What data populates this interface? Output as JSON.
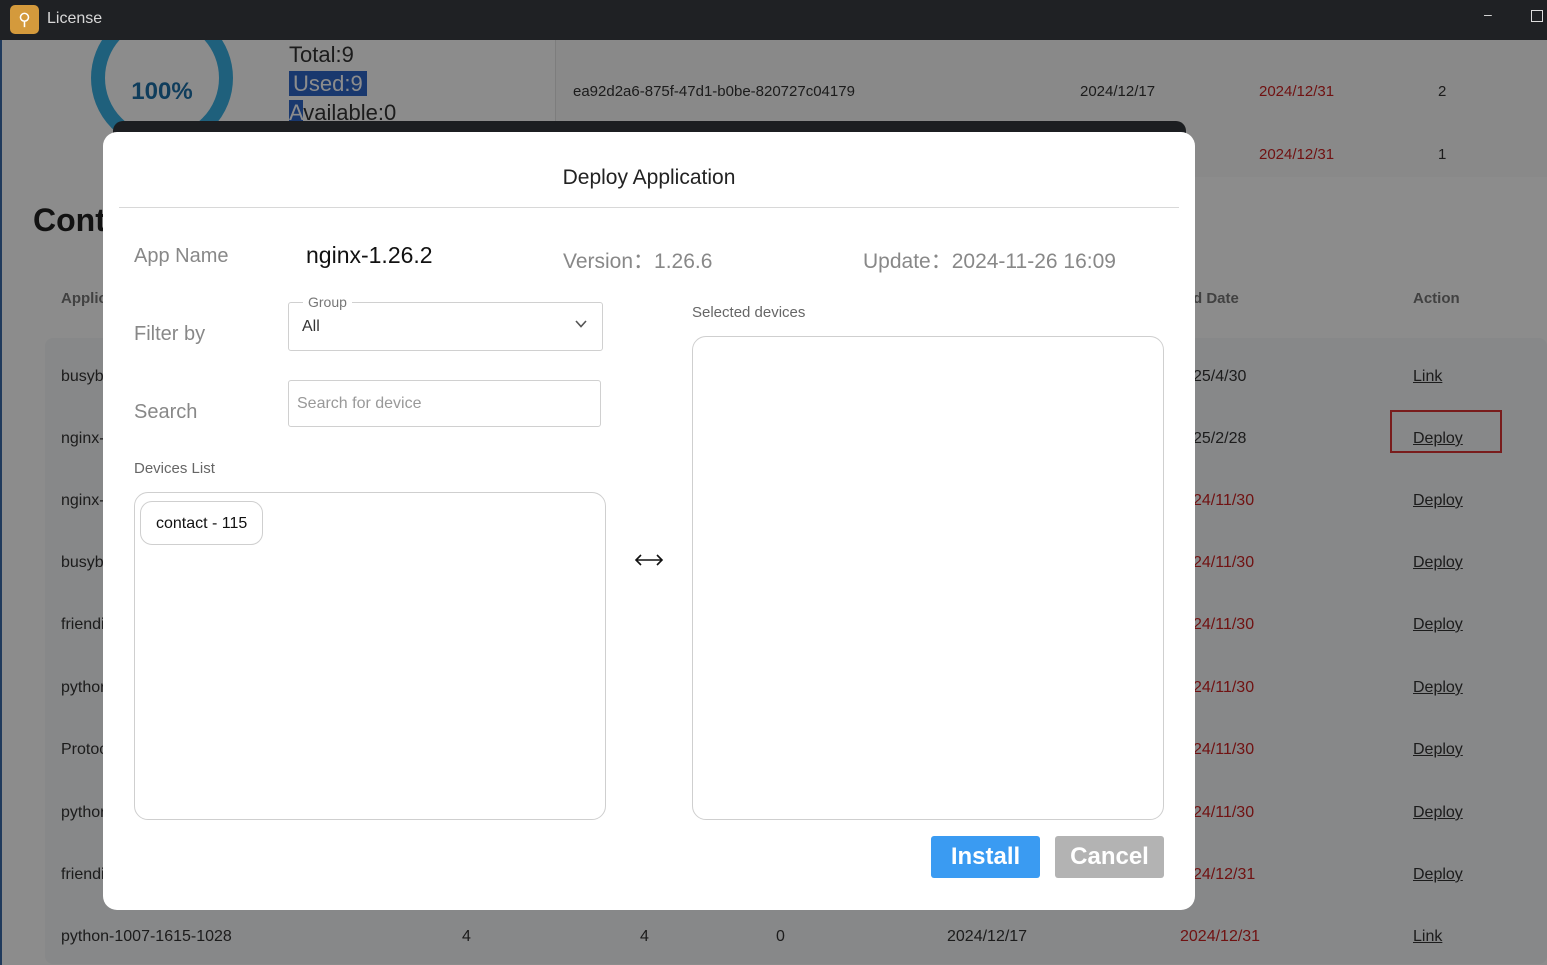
{
  "window": {
    "title": "License"
  },
  "license": {
    "percent": "100%",
    "total": "Total:9",
    "used": "Used:9",
    "available_first": "A",
    "available_rest": "vailable:0",
    "rows": [
      {
        "key": "ea92d2a6-875f-47d1-b0be-820727c04179",
        "start": "2024/12/17",
        "end": "2024/12/31",
        "count": "2"
      },
      {
        "key": "",
        "start": "",
        "end": "2024/12/31",
        "count": "1"
      }
    ]
  },
  "section": {
    "title": "Conta"
  },
  "table": {
    "headers": {
      "application": "Applic",
      "end_date": "d Date",
      "action": "Action"
    },
    "rows": [
      {
        "name": "busyb",
        "end": "25/4/30",
        "end_red": false,
        "action": "Link"
      },
      {
        "name": "nginx-",
        "end": "25/2/28",
        "end_red": false,
        "action": "Deploy"
      },
      {
        "name": "nginx-",
        "end": "24/11/30",
        "end_red": true,
        "action": "Deploy"
      },
      {
        "name": "busyb",
        "end": "24/11/30",
        "end_red": true,
        "action": "Deploy"
      },
      {
        "name": "friendi",
        "end": "24/11/30",
        "end_red": true,
        "action": "Deploy"
      },
      {
        "name": "pythor",
        "end": "24/11/30",
        "end_red": true,
        "action": "Deploy"
      },
      {
        "name": "Protoc",
        "end": "24/11/30",
        "end_red": true,
        "action": "Deploy"
      },
      {
        "name": "pythor",
        "end": "24/11/30",
        "end_red": true,
        "action": "Deploy"
      },
      {
        "name": "friendi",
        "end": "24/12/31",
        "end_red": true,
        "action": "Deploy"
      }
    ],
    "last_row": {
      "name": "python-1007-1615-1028",
      "c1": "4",
      "c2": "4",
      "c3": "0",
      "start": "2024/12/17",
      "end": "2024/12/31",
      "action": "Link"
    }
  },
  "modal": {
    "title": "Deploy Application",
    "app_name_label": "App Name",
    "app_name": "nginx-1.26.2",
    "version": "Version：1.26.6",
    "update": "Update：2024-11-26 16:09",
    "filter_label": "Filter by",
    "group_legend": "Group",
    "group_value": "All",
    "search_label": "Search",
    "search_placeholder": "Search for device",
    "devices_list_label": "Devices List",
    "devices": [
      "contact - 115"
    ],
    "selected_label": "Selected devices",
    "swap_symbol": "⟷",
    "install": "Install",
    "cancel": "Cancel"
  },
  "colors": {
    "primary": "#3a9bf2",
    "cancel": "#b3b3b3",
    "alert_red": "#cc2222",
    "ring": "#3ab0e2"
  },
  "icons": [
    "app-key-icon",
    "minimize-icon",
    "maximize-icon",
    "chevron-down-icon",
    "swap-arrows-icon"
  ]
}
